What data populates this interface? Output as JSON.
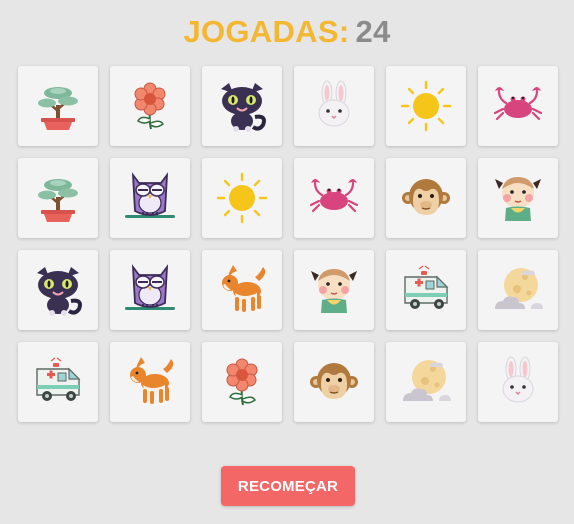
{
  "header": {
    "label": "JOGADAS:",
    "moves": "24"
  },
  "board": {
    "rows": [
      [
        "bonsai-icon",
        "flower-icon",
        "black-cat-icon",
        "rabbit-icon",
        "sun-icon",
        "crab-icon"
      ],
      [
        "bonsai-icon",
        "owl-icon",
        "sun-icon",
        "crab-icon",
        "monkey-icon",
        "baby-girl-icon"
      ],
      [
        "black-cat-icon",
        "owl-icon",
        "shiba-dog-icon",
        "baby-girl-icon",
        "ambulance-icon",
        "moon-cloud-icon"
      ],
      [
        "ambulance-icon",
        "shiba-dog-icon",
        "flower-icon",
        "monkey-icon",
        "moon-cloud-icon",
        "rabbit-icon"
      ]
    ]
  },
  "controls": {
    "restart_label": "RECOMEÇAR"
  },
  "colors": {
    "title": "#f4b731",
    "count": "#8b8b8b",
    "button": "#f46767",
    "card": "#f4f4f4",
    "background": "#e6e6e6"
  }
}
